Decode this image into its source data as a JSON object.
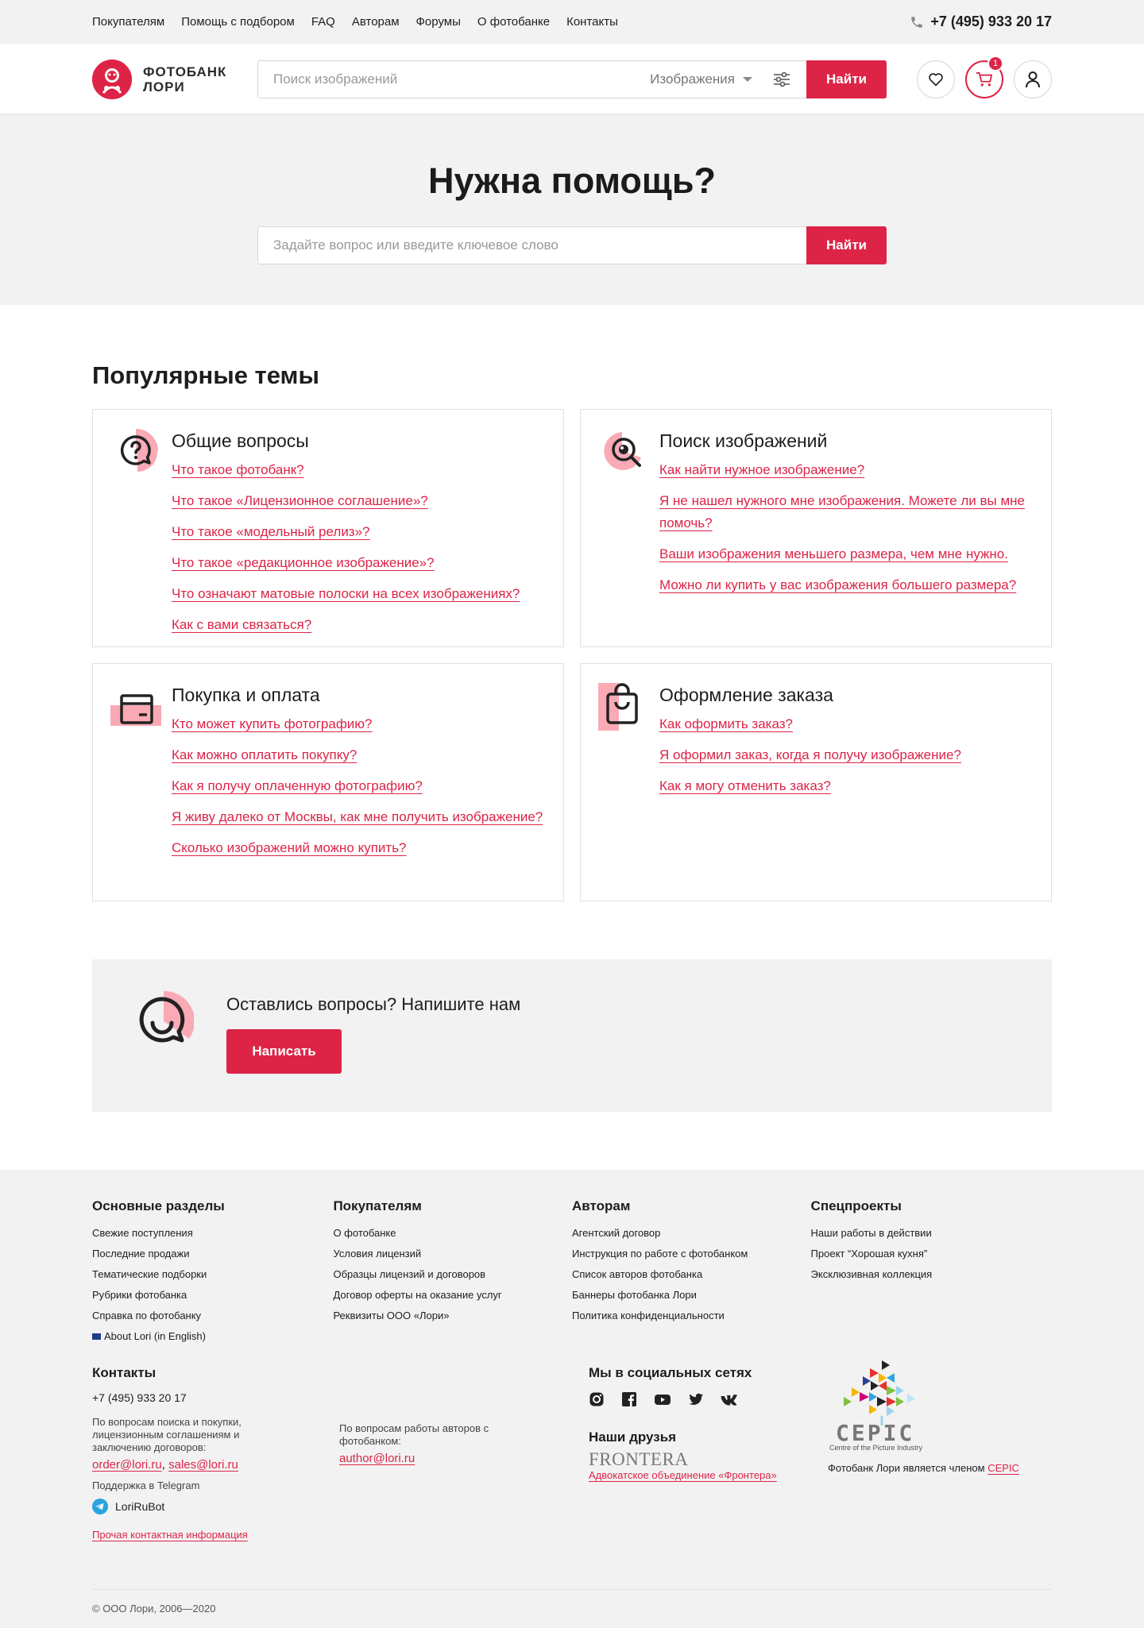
{
  "topbar": {
    "nav": [
      "Покупателям",
      "Помощь с подбором",
      "FAQ",
      "Авторам",
      "Форумы",
      "О фотобанке",
      "Контакты"
    ],
    "phone": "+7 (495) 933 20 17"
  },
  "header": {
    "logo_line1": "ФОТОБАНК",
    "logo_line2": "ЛОРИ",
    "search_placeholder": "Поиск изображений",
    "search_type": "Изображения",
    "search_button": "Найти",
    "cart_count": "1"
  },
  "hero": {
    "title": "Нужна помощь?",
    "search_placeholder": "Задайте вопрос или введите ключевое слово",
    "search_button": "Найти"
  },
  "popular": {
    "title": "Популярные темы",
    "cards": [
      {
        "title": "Общие вопросы",
        "icon": "question-icon",
        "links": [
          "Что такое фотобанк?",
          "Что такое «Лицензионное соглашение»?",
          "Что такое «модельный релиз»?",
          "Что такое «редакционное изображение»?",
          "Что означают матовые полоски на всех изображениях?",
          "Как с вами связаться?"
        ]
      },
      {
        "title": "Поиск изображений",
        "icon": "search-icon",
        "links": [
          "Как найти нужное изображение?",
          "Я не нашел нужного мне изображения. Можете ли вы мне помочь?",
          "Ваши изображения меньшего размера, чем мне нужно.",
          "Можно ли купить у вас изображения большего размера?"
        ]
      },
      {
        "title": "Покупка и оплата",
        "icon": "card-icon",
        "links": [
          "Кто может купить фотографию?",
          "Как можно оплатить покупку?",
          "Как я получу оплаченную фотографию?",
          "Я живу далеко от Москвы, как мне получить изображение?",
          "Сколько изображений можно купить?"
        ]
      },
      {
        "title": "Оформление заказа",
        "icon": "bag-icon",
        "links": [
          "Как оформить заказ?",
          "Я оформил заказ, когда я получу изображение?",
          "Как я могу отменить заказ?"
        ]
      }
    ]
  },
  "contact": {
    "title": "Оставлись вопросы? Напишите нам",
    "button": "Написать"
  },
  "footer": {
    "cols": [
      {
        "title": "Основные разделы",
        "items": [
          "Свежие поступления",
          "Последние продажи",
          "Тематические подборки",
          "Рубрики фотобанка",
          "Справка по фотобанку",
          "About Lori (in English)"
        ]
      },
      {
        "title": "Покупателям",
        "items": [
          "О фотобанке",
          "Условия лицензий",
          "Образцы лицензий и договоров",
          "Договор оферты на оказание услуг",
          "Реквизиты ООО «Лори»"
        ]
      },
      {
        "title": "Авторам",
        "items": [
          "Агентский договор",
          "Инструкция по работе с фотобанком",
          "Список авторов фотобанка",
          "Баннеры фотобанка Лори",
          "Политика конфиденциальности"
        ]
      },
      {
        "title": "Спецпроекты",
        "items": [
          "Наши работы в действии",
          "Проект “Хорошая кухня”",
          "Эксклюзивная коллекция"
        ]
      }
    ],
    "contacts": {
      "title": "Контакты",
      "phone": "+7 (495) 933 20 17",
      "buyers_note": "По вопросам поиска и покупки, лицензионным соглашениям и заключению договоров:",
      "email1": "order@lori.ru",
      "email2": "sales@lori.ru",
      "authors_note": "По вопросам работы авторов с фотобанком:",
      "email3": "author@lori.ru",
      "telegram_label": "Поддержка в Telegram",
      "telegram_bot": "LoriRuBot",
      "other": "Прочая контактная информация"
    },
    "social": {
      "title": "Мы в социальных сетях",
      "icons": [
        "instagram-icon",
        "facebook-icon",
        "youtube-icon",
        "twitter-icon",
        "vk-icon"
      ]
    },
    "friends": {
      "title": "Наши друзья",
      "logo": "FRONTERA",
      "link": "Адвокатское объединение «Фронтера»"
    },
    "cepic": {
      "logo": "CEPIC",
      "subtitle": "Centre of the Picture Industry",
      "member_text": "Фотобанк Лори является членом",
      "member_link": "CEPIC"
    },
    "copyright": "© ООО Лори, 2006—2020"
  },
  "colors": {
    "accent": "#dd2447",
    "accent_light": "#f9aab5",
    "bg_gray": "#f2f2f2"
  }
}
